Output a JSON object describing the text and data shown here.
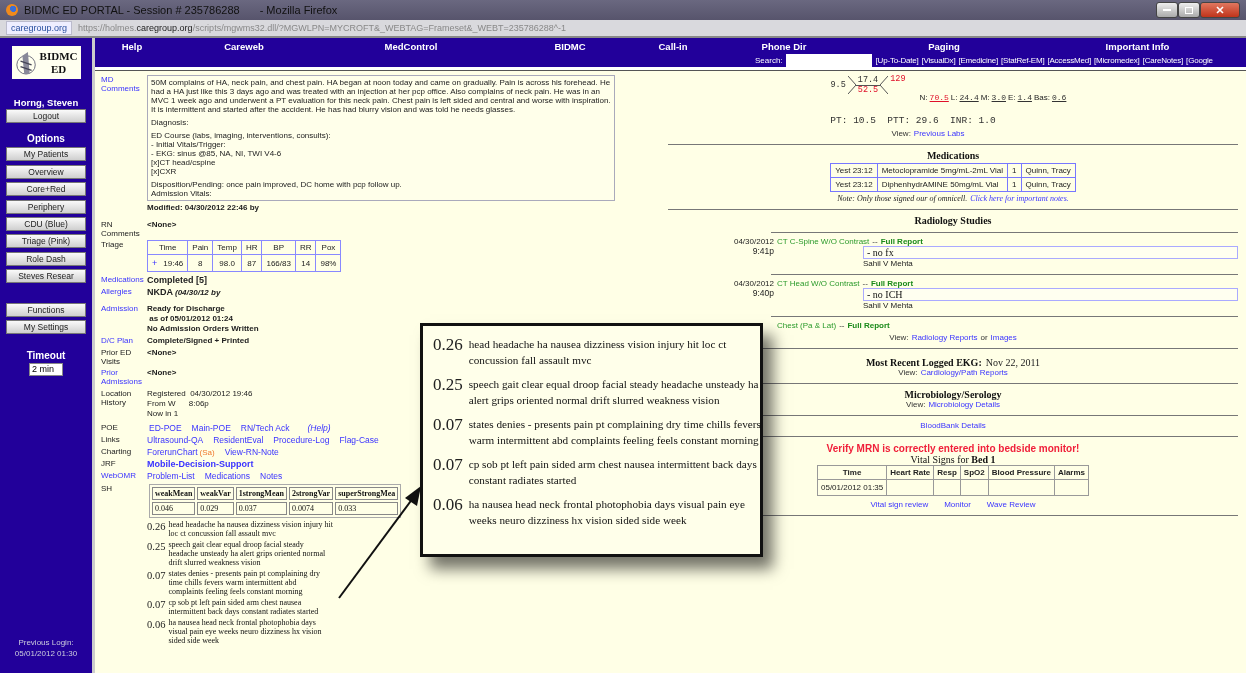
{
  "browser": {
    "title": "BIDMC ED PORTAL - Session # 235786288",
    "app": "- Mozilla Firefox",
    "site": "caregroup.org",
    "url": "https://holmes.**caregroup.org**/scripts/mgwms32.dll/?MGWLPN=MYCROFT&_WEBTAG=Frameset&_WEBT=235786288^-1"
  },
  "sidebar": {
    "logo": [
      "BIDMC",
      "ED"
    ],
    "user": "Horng, Steven",
    "logout": "Logout",
    "options_heading": "Options",
    "options": [
      "My Patients",
      "Overview",
      "Core+Red",
      "Periphery",
      "CDU (Blue)",
      "Triage (Pink)",
      "Role Dash",
      "Steves Resear"
    ],
    "tools": [
      "Functions",
      "My Settings"
    ],
    "timeout_label": "Timeout",
    "timeout_value": "2 min",
    "previous_login": [
      "Previous Login:",
      "05/01/2012 01:30"
    ]
  },
  "nav": {
    "items": [
      "Help",
      "Careweb",
      "MedControl",
      "BIDMC",
      "Call-in",
      "Phone Dir",
      "Paging",
      "Important Info"
    ],
    "search_label": "Search:",
    "links": [
      "[Up-To-Date]",
      "[VisualDx]",
      "[Emedicine]",
      "[StatRef-EM]",
      "[AccessMed]",
      "[Micromedex]",
      "[CareNotes]",
      "[Google"
    ]
  },
  "record": {
    "md_comments": {
      "label": "MD Comments",
      "paragraphs": [
        "50M complains of HA, neck pain, and chest pain. HA began at noon today and came on gradually. Pain is across his forehead. He had a HA just like this 3 days ago and was treated with an injection at her pcp office. Also complains of neck pain. He was in an MVC 1 week ago and underwent a PT evaluation for this neck pain. Chest pain is left sided and central and worse with inspiration. It is intermittent and started after the accident. He has had blurry vision and was told he needs glasses.",
        "Diagnosis:",
        "ED Course (labs, imaging, interventions, consults):\n- Initial Vitals/Trigger:\n- EKG: sinus @85, NA, NI, TWI V4-6\n[x]CT head/cspine\n[x]CXR",
        "Disposition/Pending: once pain improved, DC home with pcp follow up.\nAdmission Vitals:"
      ],
      "modified": "Modified: 04/30/2012 22:46 by"
    },
    "rn_comments": {
      "label": "RN Comments",
      "value": "<None>"
    },
    "triage": {
      "label": "Triage",
      "columns": [
        "Time",
        "Pain",
        "Temp",
        "HR",
        "BP",
        "RR",
        "Pox"
      ],
      "expand": "+",
      "row": [
        "19:46",
        "8",
        "98.0",
        "87",
        "166/83",
        "14",
        "98%"
      ]
    },
    "fields": [
      {
        "label": "Medications",
        "link": true,
        "lines": [
          "Completed [5]"
        ],
        "kind": "large"
      },
      {
        "label": "Allergies",
        "link": true,
        "lines": [
          "NKDA"
        ],
        "note": "(04/30/12 by",
        "kind": "large"
      },
      {
        "label": "Admission",
        "link": true,
        "lines": [
          "Ready for Discharge",
          " as of 05/01/2012 01:24",
          "No Admission Orders Written"
        ],
        "kind": "bold"
      },
      {
        "label": "D/C Plan",
        "link": true,
        "lines": [
          "Complete/Signed + Printed"
        ],
        "kind": "bold"
      },
      {
        "label": "Prior ED Visits",
        "link": false,
        "lines": [
          "<None>"
        ],
        "kind": "small"
      },
      {
        "label": "Prior Admissions",
        "link": true,
        "lines": [
          "<None>"
        ],
        "kind": "small"
      },
      {
        "label": "Location History",
        "link": false,
        "lines": [
          "Registered  04/30/2012 19:46",
          "From W      8:06p",
          "Now in 1"
        ],
        "kind": "plain"
      }
    ],
    "link_rows": [
      {
        "label": "POE",
        "link": false,
        "links": [
          "ED-POE",
          "Main-POE",
          "RN/Tech Ack"
        ],
        "help": "(Help)"
      },
      {
        "label": "Links",
        "link": false,
        "links": [
          "Ultrasound-QA",
          "ResidentEval",
          "Procedure-Log",
          "Flag-Case"
        ]
      },
      {
        "label": "Charting",
        "link": false,
        "links": [
          "ForerunChart"
        ],
        "badge": "(Sa)",
        "after": [
          "View-RN-Note"
        ]
      },
      {
        "label": "JRF",
        "link": false,
        "links": [
          "Mobile-Decision-Support"
        ],
        "bold": true
      },
      {
        "label": "WebOMR",
        "link": true,
        "links": [
          "Problem-List",
          "Medications",
          "Notes"
        ]
      }
    ],
    "sh": {
      "label": "SH",
      "columns": [
        "weakMean",
        "weakVar",
        "1strongMean",
        "2strongVar",
        "superStrongMea"
      ],
      "values": [
        "0.046",
        "0.029",
        "0.037",
        "0.0074",
        "0.033"
      ],
      "topics": [
        {
          "score": "0.26",
          "terms": "head headache ha nausea dizziness vision injury hit loc ct concussion fall assault mvc"
        },
        {
          "score": "0.25",
          "terms": "speech gait clear equal droop facial steady headache unsteady ha alert grips oriented normal drift slurred weakness vision"
        },
        {
          "score": "0.07",
          "terms": "states denies - presents pain pt complaining dry time chills fevers warm intermittent abd complaints feeling feels constant morning"
        },
        {
          "score": "0.07",
          "terms": "cp sob pt left pain sided arm chest nausea intermittent back days constant radiates started"
        },
        {
          "score": "0.06",
          "terms": "ha nausea head neck frontal photophobia days visual pain eye weeks neuro dizziness hx vision sided side week"
        }
      ]
    }
  },
  "labs": {
    "cbc": {
      "wbc": "9.5",
      "hgb": "17.4",
      "hct": "52.5",
      "hct_abnormal": true,
      "plt": "129",
      "plt_abnormal": true
    },
    "diff": [
      {
        "label": "N:",
        "value": "70.5",
        "abnormal": true
      },
      {
        "label": "L:",
        "value": "24.4",
        "abnormal": false
      },
      {
        "label": "M:",
        "value": "3.0",
        "abnormal": false
      },
      {
        "label": "E:",
        "value": "1.4",
        "abnormal": false
      },
      {
        "label": "Bas:",
        "value": "0.6",
        "abnormal": false
      }
    ],
    "coags": "PT: 10.5  PTT: 29.6  INR: 1.0",
    "view_label": "View:",
    "view_link": "Previous Labs"
  },
  "medications": {
    "heading": "Medications",
    "rows": [
      [
        "Yest 23:12",
        "Metoclopramide 5mg/mL-2mL Vial",
        "1",
        "Quinn, Tracy"
      ],
      [
        "Yest 23:12",
        "DiphenhydrAMINE 50mg/mL Vial",
        "1",
        "Quinn, Tracy"
      ]
    ],
    "note": "Note: Only those signed our of omnicell.",
    "note_link": "Click here for important notes."
  },
  "radiology": {
    "heading": "Radiology Studies",
    "studies": [
      {
        "date": "04/30/2012",
        "time": "9:41p",
        "name": "CT C-Spine W/O Contrast",
        "sep": "--",
        "report": "Full Report",
        "result": "- no fx",
        "reader": "Sahil V Mehta"
      },
      {
        "date": "04/30/2012",
        "time": "9:40p",
        "name": "CT Head W/O Contrast",
        "sep": "--",
        "report": "Full Report",
        "result": "- no ICH",
        "reader": "Sahil V Mehta"
      },
      {
        "name": "Chest (Pa & Lat)",
        "sep": "--",
        "report": "Full Report"
      }
    ],
    "view_label": "View:",
    "links": [
      "Radiology Reports",
      "Images"
    ],
    "or": "or"
  },
  "ekg": {
    "heading": "Most Recent Logged EKG:",
    "date": "Nov 22, 2011",
    "view_label": "View:",
    "link": "Cardiology/Path Reports"
  },
  "micro": {
    "heading": "Microbiology/Serology",
    "view_label": "View:",
    "link": "Microbiology Details"
  },
  "bloodbank": "BloodBank Details",
  "monitor": {
    "warning": "Verify MRN is correctly entered into bedside monitor!",
    "title": "Vital Signs for **Bed 1**",
    "columns": [
      "Time",
      "Heart Rate",
      "Resp",
      "SpO2",
      "Blood Pressure",
      "Alarms"
    ],
    "row": [
      "05/01/2012 01:35"
    ],
    "links": [
      "Vital sign review",
      "Monitor",
      "Wave Review"
    ]
  },
  "callout": {
    "topics": [
      {
        "score": "0.26",
        "terms": "head headache ha nausea dizziness vision injury hit loc ct concussion fall assault mvc"
      },
      {
        "score": "0.25",
        "terms": "speech gait clear equal droop facial steady headache unsteady ha alert grips oriented normal drift slurred weakness vision"
      },
      {
        "score": "0.07",
        "terms": "states denies - presents pain pt complaining dry time chills fevers warm intermittent abd complaints feeling feels constant morning"
      },
      {
        "score": "0.07",
        "terms": "cp sob pt left pain sided arm chest nausea intermittent back days constant radiates started"
      },
      {
        "score": "0.06",
        "terms": "ha nausea head neck frontal photophobia days visual pain eye weeks neuro dizziness hx vision sided side week"
      }
    ]
  }
}
